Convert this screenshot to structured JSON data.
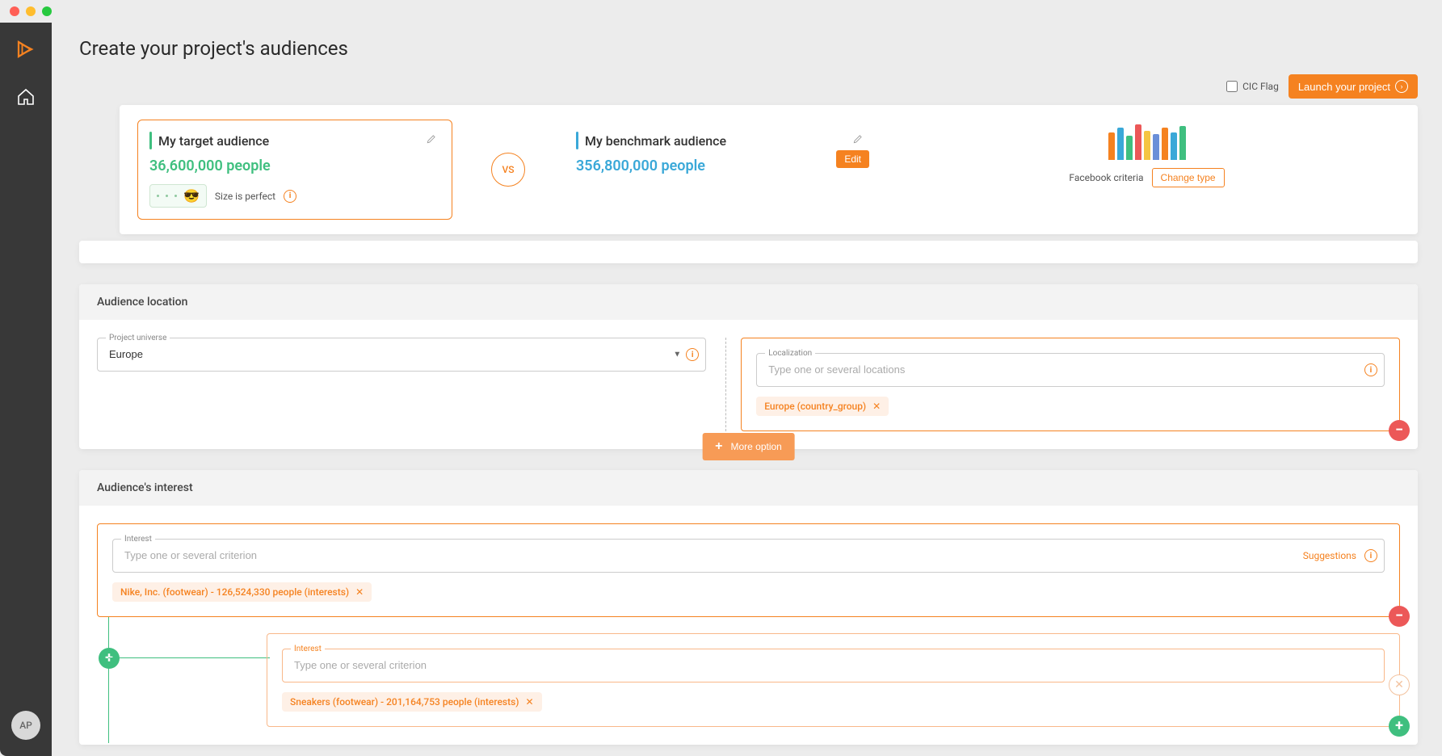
{
  "sidebar": {
    "avatar_initials": "AP"
  },
  "header": {
    "cic_flag_label": "CIC Flag",
    "launch_label": "Launch your project"
  },
  "page_title": "Create your project's audiences",
  "target": {
    "title": "My target audience",
    "count": "36,600,000 people",
    "size_status": "Size is perfect"
  },
  "vs_label": "VS",
  "benchmark": {
    "title": "My benchmark audience",
    "count": "356,800,000 people",
    "edit_label": "Edit"
  },
  "criteria": {
    "source_label": "Facebook criteria",
    "change_type_label": "Change type"
  },
  "location": {
    "section_title": "Audience location",
    "universe_label": "Project universe",
    "universe_value": "Europe",
    "localization_label": "Localization",
    "localization_placeholder": "Type one or several locations",
    "tag": "Europe (country_group)",
    "more_option_label": "More option"
  },
  "interest": {
    "section_title": "Audience's interest",
    "legend": "Interest",
    "placeholder": "Type one or several criterion",
    "suggestions_label": "Suggestions",
    "tag1": "Nike, Inc. (footwear) - 126,524,330 people (interests)",
    "tag2": "Sneakers (footwear) - 201,164,753 people (interests)"
  }
}
